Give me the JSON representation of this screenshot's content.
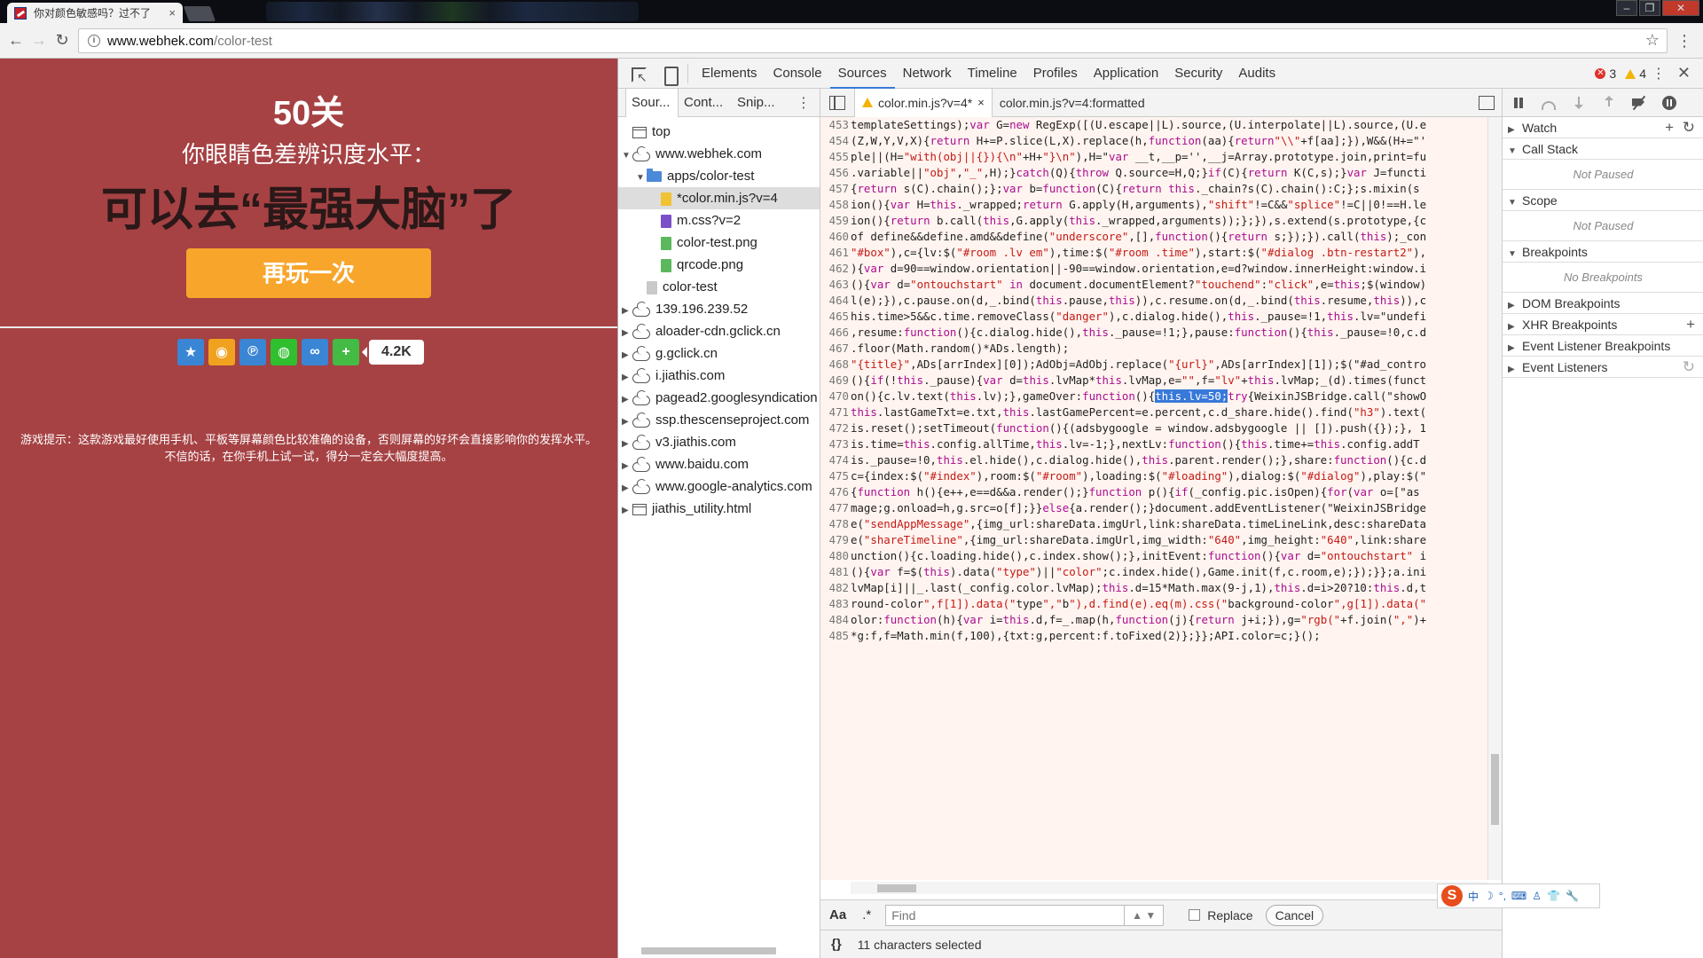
{
  "browser": {
    "tab_title": "你对颜色敏感吗？过不了",
    "tab_close": "×",
    "url_host": "www.webhek.com",
    "url_path": "/color-test",
    "bookmark_star": "☆",
    "menu_dots": "⋮",
    "back": "←",
    "forward": "→",
    "reload": "↻"
  },
  "game": {
    "level": "50关",
    "subtitle": "你眼睛色差辨识度水平：",
    "result": "可以去“最强大脑”了",
    "play_again": "再玩一次",
    "share_count": "4.2K",
    "tip_line1": "游戏提示：这款游戏最好使用手机、平板等屏幕颜色比较准确的设备，否则屏幕的好坏会直接影响你的发挥水平。",
    "tip_line2": "不信的话，在你手机上试一试，得分一定会大幅度提高。",
    "share_icons": [
      {
        "name": "qzone",
        "color": "#3a86d4",
        "glyph": "★"
      },
      {
        "name": "weibo",
        "color": "#f0a21f",
        "glyph": "◉"
      },
      {
        "name": "tencent-weibo",
        "color": "#3a86d4",
        "glyph": "℗"
      },
      {
        "name": "wechat",
        "color": "#2fbf2f",
        "glyph": "◍"
      },
      {
        "name": "renren",
        "color": "#3a86d4",
        "glyph": "∞"
      },
      {
        "name": "more",
        "color": "#44bb44",
        "glyph": "+"
      }
    ]
  },
  "devtools": {
    "tabs": [
      "Elements",
      "Console",
      "Sources",
      "Network",
      "Timeline",
      "Profiles",
      "Application",
      "Security",
      "Audits"
    ],
    "active_tab": "Sources",
    "error_count": "3",
    "warning_count": "4",
    "close": "✕",
    "more": "⋮",
    "navigator": {
      "tabs": [
        "Sour...",
        "Cont...",
        "Snip..."
      ],
      "more": "⋮",
      "tree": [
        {
          "label": "top",
          "icon": "frame",
          "depth": 0,
          "arrow": ""
        },
        {
          "label": "www.webhek.com",
          "icon": "cloud",
          "depth": 0,
          "arrow": "▼"
        },
        {
          "label": "apps/color-test",
          "icon": "folder",
          "depth": 1,
          "arrow": "▼"
        },
        {
          "label": "*color.min.js?v=4",
          "icon": "js",
          "depth": 2,
          "arrow": "",
          "selected": true
        },
        {
          "label": "m.css?v=2",
          "icon": "css",
          "depth": 2,
          "arrow": ""
        },
        {
          "label": "color-test.png",
          "icon": "img",
          "depth": 2,
          "arrow": ""
        },
        {
          "label": "qrcode.png",
          "icon": "img",
          "depth": 2,
          "arrow": ""
        },
        {
          "label": "color-test",
          "icon": "doc",
          "depth": 1,
          "arrow": ""
        },
        {
          "label": "139.196.239.52",
          "icon": "cloud",
          "depth": 0,
          "arrow": "▶"
        },
        {
          "label": "aloader-cdn.gclick.cn",
          "icon": "cloud",
          "depth": 0,
          "arrow": "▶"
        },
        {
          "label": "g.gclick.cn",
          "icon": "cloud",
          "depth": 0,
          "arrow": "▶"
        },
        {
          "label": "i.jiathis.com",
          "icon": "cloud",
          "depth": 0,
          "arrow": "▶"
        },
        {
          "label": "pagead2.googlesyndication",
          "icon": "cloud",
          "depth": 0,
          "arrow": "▶"
        },
        {
          "label": "ssp.thescenseproject.com",
          "icon": "cloud",
          "depth": 0,
          "arrow": "▶"
        },
        {
          "label": "v3.jiathis.com",
          "icon": "cloud",
          "depth": 0,
          "arrow": "▶"
        },
        {
          "label": "www.baidu.com",
          "icon": "cloud",
          "depth": 0,
          "arrow": "▶"
        },
        {
          "label": "www.google-analytics.com",
          "icon": "cloud",
          "depth": 0,
          "arrow": "▶"
        },
        {
          "label": "jiathis_utility.html",
          "icon": "frame",
          "depth": 0,
          "arrow": "▶"
        }
      ]
    },
    "editor": {
      "tabs": [
        {
          "label": "color.min.js?v=4*",
          "modified": true,
          "close": "×"
        },
        {
          "label": "color.min.js?v=4:formatted"
        }
      ],
      "lines": [
        {
          "n": "453",
          "t": "templateSettings);var G=new RegExp([(U.escape||L).source,(U.interpolate||L).source,(U.e"
        },
        {
          "n": "454",
          "t": "(Z,W,Y,V,X){return H+=P.slice(L,X).replace(h,function(aa){return\"\\\\\"+f[aa];}),W&&(H+=\"'"
        },
        {
          "n": "455",
          "t": "ple||(H=\"with(obj||{}){\\n\"+H+\"}\\n\"),H=\"var __t,__p='',__j=Array.prototype.join,print=fu"
        },
        {
          "n": "456",
          "t": ".variable||\"obj\",\"_\",H);}catch(Q){throw Q.source=H,Q;}if(C){return K(C,s);}var J=functi"
        },
        {
          "n": "457",
          "t": "{return s(C).chain();};var b=function(C){return this._chain?s(C).chain():C;};s.mixin(s"
        },
        {
          "n": "458",
          "t": "ion(){var H=this._wrapped;return G.apply(H,arguments),\"shift\"!=C&&\"splice\"!=C||0!==H.le"
        },
        {
          "n": "459",
          "t": "ion(){return b.call(this,G.apply(this._wrapped,arguments));};}),s.extend(s.prototype,{c"
        },
        {
          "n": "460",
          "t": "of define&&define.amd&&define(\"underscore\",[],function(){return s;});}).call(this);_con"
        },
        {
          "n": "461",
          "t": "\"#box\"),c={lv:$(\"#room .lv em\"),time:$(\"#room .time\"),start:$(\"#dialog .btn-restart2\"),"
        },
        {
          "n": "462",
          "t": "){var d=90==window.orientation||-90==window.orientation,e=d?window.innerHeight:window.i"
        },
        {
          "n": "463",
          "t": "(){var d=\"ontouchstart\" in document.documentElement?\"touchend\":\"click\",e=this;$(window)"
        },
        {
          "n": "464",
          "t": "l(e);}),c.pause.on(d,_.bind(this.pause,this)),c.resume.on(d,_.bind(this.resume,this)),c"
        },
        {
          "n": "465",
          "t": "his.time>5&&c.time.removeClass(\"danger\"),c.dialog.hide(),this._pause=!1,this.lv=\"undefi"
        },
        {
          "n": "466",
          "t": ",resume:function(){c.dialog.hide(),this._pause=!1;},pause:function(){this._pause=!0,c.d"
        },
        {
          "n": "467",
          "t": ".floor(Math.random()*ADs.length);"
        },
        {
          "n": "468",
          "t": "\"{title}\",ADs[arrIndex][0]);AdObj=AdObj.replace(\"{url}\",ADs[arrIndex][1]);$(\"#ad_contro"
        },
        {
          "n": "469",
          "t": "(){if(!this._pause){var d=this.lvMap*this.lvMap,e=\"\",f=\"lv\"+this.lvMap;_(d).times(funct"
        },
        {
          "n": "470",
          "pre": "on(){c.lv.text(this.lv);},gameOver:function(){",
          "sel": "this.lv=50;",
          "post": "try{WeixinJSBridge.call(\"showO"
        },
        {
          "n": "471",
          "t": "this.lastGameTxt=e.txt,this.lastGamePercent=e.percent,c.d_share.hide().find(\"h3\").text("
        },
        {
          "n": "472",
          "t": "is.reset();setTimeout(function(){(adsbygoogle = window.adsbygoogle || []).push({});}, 1"
        },
        {
          "n": "473",
          "t": "is.time=this.config.allTime,this.lv=-1;},nextLv:function(){this.time+=this.config.addT"
        },
        {
          "n": "474",
          "t": "is._pause=!0,this.el.hide(),c.dialog.hide(),this.parent.render();},share:function(){c.d"
        },
        {
          "n": "475",
          "t": "c={index:$(\"#index\"),room:$(\"#room\"),loading:$(\"#loading\"),dialog:$(\"#dialog\"),play:$(\""
        },
        {
          "n": "476",
          "t": "{function h(){e++,e==d&&a.render();}function p(){if(_config.pic.isOpen){for(var o=[\"as"
        },
        {
          "n": "477",
          "t": "mage;g.onload=h,g.src=o[f];}}else{a.render();}document.addEventListener(\"WeixinJSBridge"
        },
        {
          "n": "478",
          "t": "e(\"sendAppMessage\",{img_url:shareData.imgUrl,link:shareData.timeLineLink,desc:shareData"
        },
        {
          "n": "479",
          "t": "e(\"shareTimeline\",{img_url:shareData.imgUrl,img_width:\"640\",img_height:\"640\",link:share"
        },
        {
          "n": "480",
          "t": "unction(){c.loading.hide(),c.index.show();},initEvent:function(){var d=\"ontouchstart\" i"
        },
        {
          "n": "481",
          "t": "(){var f=$(this).data(\"type\")||\"color\";c.index.hide(),Game.init(f,c.room,e);});}};a.ini"
        },
        {
          "n": "482",
          "t": "lvMap[i]||_.last(_config.color.lvMap);this.d=15*Math.max(9-j,1),this.d=i>20?10:this.d,t"
        },
        {
          "n": "483",
          "t": "round-color\",f[1]).data(\"type\",\"b\"),d.find(e).eq(m).css(\"background-color\",g[1]).data(\""
        },
        {
          "n": "484",
          "t": "olor:function(h){var i=this.d,f=_.map(h,function(j){return j+i;}),g=\"rgb(\"+f.join(\",\")+"
        },
        {
          "n": "485",
          "t": "*g:f,f=Math.min(f,100),{txt:g,percent:f.toFixed(2)};}};API.color=c;}();"
        }
      ],
      "find": {
        "case_label": "Aa",
        "regex_label": ".*",
        "placeholder": "Find",
        "arrows": "▲ ▼",
        "replace_label": "Replace",
        "cancel_label": "Cancel"
      },
      "status": {
        "braces": "{}",
        "text": "11 characters selected"
      }
    },
    "debugger": {
      "watch": "Watch",
      "watch_add": "+",
      "watch_refresh": "↻",
      "call_stack": "Call Stack",
      "call_stack_empty": "Not Paused",
      "scope": "Scope",
      "scope_empty": "Not Paused",
      "breakpoints": "Breakpoints",
      "breakpoints_empty": "No Breakpoints",
      "dom_breakpoints": "DOM Breakpoints",
      "xhr_breakpoints": "XHR Breakpoints",
      "xhr_add": "+",
      "event_listener_breakpoints": "Event Listener Breakpoints",
      "event_listeners": "Event Listeners",
      "event_listeners_refresh": "↻"
    }
  },
  "ime": {
    "logo": "S",
    "items": [
      "中",
      "☽",
      "°,",
      "⌨",
      "♙",
      "👕",
      "🔧"
    ]
  }
}
